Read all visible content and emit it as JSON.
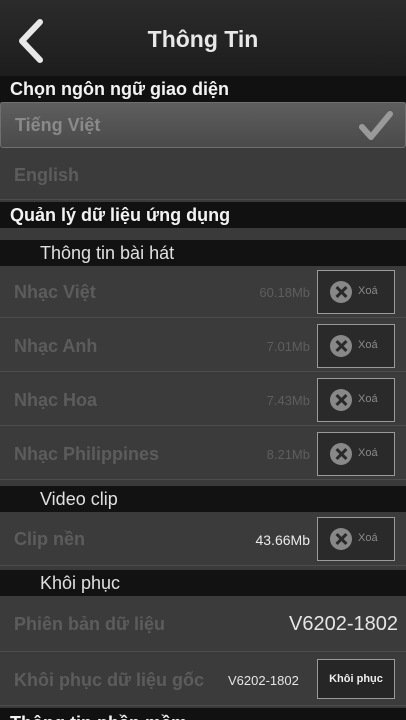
{
  "navbar": {
    "title": "Thông Tin"
  },
  "language": {
    "header": "Chọn ngôn ngữ giao diện",
    "selected": "Tiếng Việt",
    "other": "English"
  },
  "data_mgmt": {
    "header": "Quản lý dữ liệu ứng dụng",
    "songs_header": "Thông tin bài hát",
    "items": [
      {
        "label": "Nhạc Việt",
        "size": "60.18Mb",
        "delete": "Xoá"
      },
      {
        "label": "Nhạc Anh",
        "size": "7.01Mb",
        "delete": "Xoá"
      },
      {
        "label": "Nhạc Hoa",
        "size": "7.43Mb",
        "delete": "Xoá"
      },
      {
        "label": "Nhạc Philippines",
        "size": "8.21Mb",
        "delete": "Xoá"
      }
    ],
    "video_header": "Video clip",
    "clip": {
      "label": "Clip nền",
      "size": "43.66Mb",
      "delete": "Xoá"
    }
  },
  "restore": {
    "header": "Khôi phục",
    "version_label": "Phiên bản dữ liệu",
    "version_value": "V6202-1802",
    "restore_label": "Khôi phục dữ liệu gốc",
    "restore_version": "V6202-1802",
    "restore_button": "Khôi phục"
  },
  "bottom_section": "Thông tin phần mềm"
}
